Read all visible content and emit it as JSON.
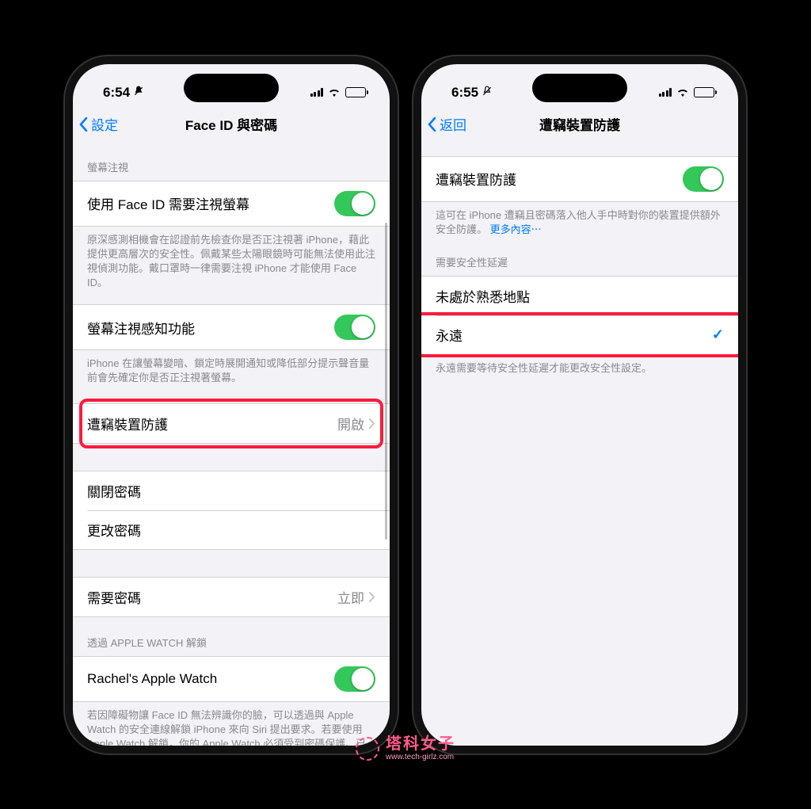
{
  "left": {
    "time": "6:54",
    "nav_back": "設定",
    "nav_title": "Face ID 與密碼",
    "section1_header": "螢幕注視",
    "row_attention_label": "使用 Face ID 需要注視螢幕",
    "section1_footer": "原深感測相機會在認證前先檢查你是否正注視著 iPhone，藉此提供更高層次的安全性。佩戴某些太陽眼鏡時可能無法使用此注視偵測功能。戴口罩時一律需要注視 iPhone 才能使用 Face ID。",
    "row_aware_label": "螢幕注視感知功能",
    "row_aware_footer": "iPhone 在讓螢幕變暗、鎖定時展開通知或降低部分提示聲音量前會先確定你是否正注視著螢幕。",
    "row_stolen_label": "遭竊裝置防護",
    "row_stolen_value": "開啟",
    "row_turnoff_label": "關閉密碼",
    "row_change_label": "更改密碼",
    "row_require_label": "需要密碼",
    "row_require_value": "立即",
    "section_watch_header": "透過 APPLE WATCH 解鎖",
    "row_watch_label": "Rachel's Apple Watch",
    "section_watch_footer": "若因障礙物讓 Face ID 無法辨識你的臉，可以透過與 Apple Watch 的安全連線解鎖 iPhone 來向 Siri 提出要求。若要使用 Apple Watch 解鎖，你的 Apple Watch 必須受到密碼保護、已解鎖且戴在靠近的手腕上。"
  },
  "right": {
    "time": "6:55",
    "nav_back": "返回",
    "nav_title": "遭竊裝置防護",
    "row_protect_label": "遭竊裝置防護",
    "row_protect_footer_a": "這可在 iPhone 遭竊且密碼落入他人手中時對你的裝置提供額外安全防護。",
    "row_protect_footer_link": "更多內容⋯",
    "section_delay_header": "需要安全性延遲",
    "row_away_label": "未處於熟悉地點",
    "row_always_label": "永遠",
    "row_always_footer": "永遠需要等待安全性延遲才能更改安全性設定。"
  },
  "watermark": {
    "cn": "塔科女子",
    "en": "www.tech-girlz.com"
  }
}
